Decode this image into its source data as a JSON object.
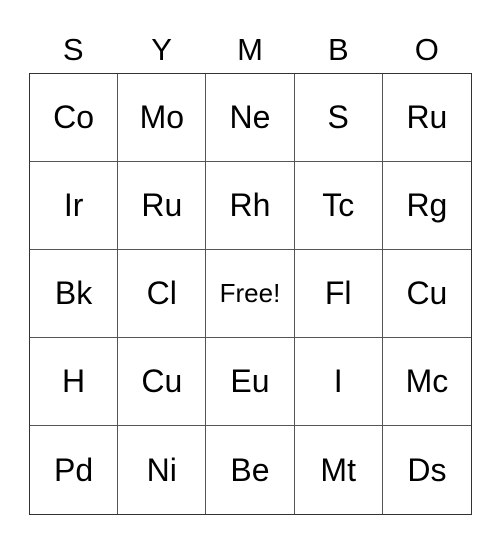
{
  "header": [
    "S",
    "Y",
    "M",
    "B",
    "O"
  ],
  "rows": [
    [
      "Co",
      "Mo",
      "Ne",
      "S",
      "Ru"
    ],
    [
      "Ir",
      "Ru",
      "Rh",
      "Tc",
      "Rg"
    ],
    [
      "Bk",
      "Cl",
      "Free!",
      "Fl",
      "Cu"
    ],
    [
      "H",
      "Cu",
      "Eu",
      "I",
      "Mc"
    ],
    [
      "Pd",
      "Ni",
      "Be",
      "Mt",
      "Ds"
    ]
  ]
}
